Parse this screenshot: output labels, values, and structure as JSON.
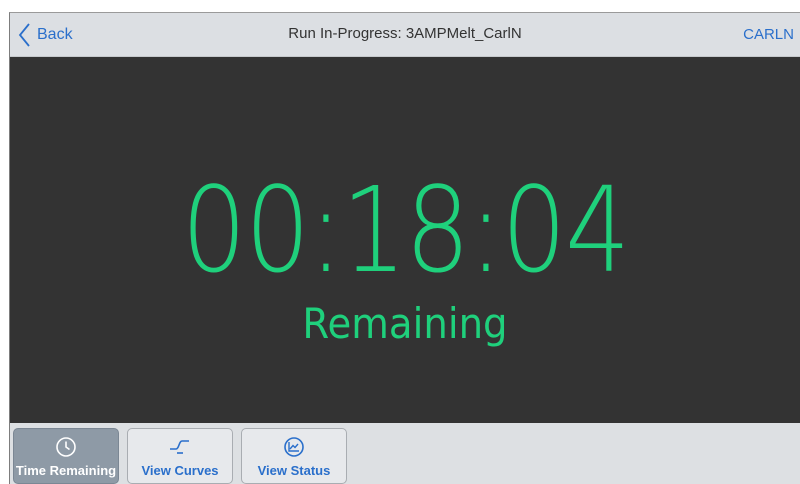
{
  "header": {
    "back_label": "Back",
    "title": "Run In-Progress: 3AMPMelt_CarlN",
    "user": "CARLN"
  },
  "main": {
    "time_remaining": "00:18:04",
    "remaining_label": "Remaining",
    "accent_color": "#1fd07c",
    "background_color": "#333333"
  },
  "tabs": [
    {
      "label": "Time Remaining",
      "icon": "clock-icon",
      "active": true
    },
    {
      "label": "View Curves",
      "icon": "curve-icon",
      "active": false
    },
    {
      "label": "View Status",
      "icon": "status-chart-icon",
      "active": false
    }
  ]
}
